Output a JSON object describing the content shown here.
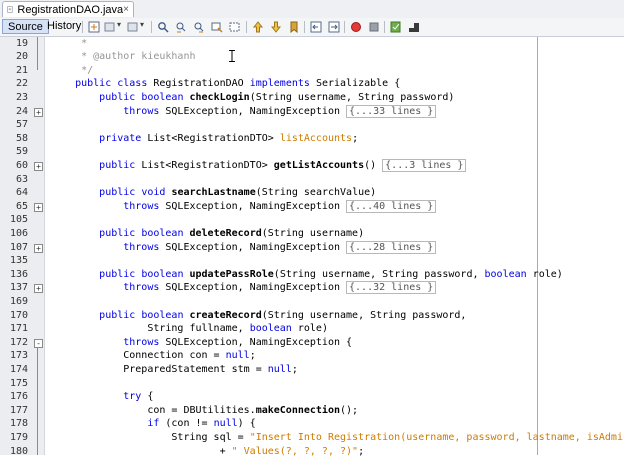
{
  "tab": {
    "title": "RegistrationDAO.java",
    "close": "×"
  },
  "toolbar": {
    "source": "Source",
    "history": "History"
  },
  "lines": [
    {
      "n": "19",
      "fold": "",
      "tokens": [
        {
          "t": "     *",
          "c": "cmt"
        }
      ]
    },
    {
      "n": "20",
      "fold": "",
      "tokens": [
        {
          "t": "     * @author kieukhanh",
          "c": "cmt"
        }
      ]
    },
    {
      "n": "21",
      "fold": "",
      "tokens": [
        {
          "t": "     */",
          "c": "cmt"
        }
      ]
    },
    {
      "n": "22",
      "fold": "",
      "tokens": [
        {
          "t": "    ",
          "c": ""
        },
        {
          "t": "public class",
          "c": "kw"
        },
        {
          "t": " RegistrationDAO ",
          "c": ""
        },
        {
          "t": "implements",
          "c": "kw"
        },
        {
          "t": " Serializable {",
          "c": ""
        }
      ]
    },
    {
      "n": "23",
      "fold": "",
      "tokens": [
        {
          "t": "        ",
          "c": ""
        },
        {
          "t": "public boolean",
          "c": "kw"
        },
        {
          "t": " ",
          "c": ""
        },
        {
          "t": "checkLogin",
          "c": "b"
        },
        {
          "t": "(String username, String password)",
          "c": ""
        }
      ]
    },
    {
      "n": "24",
      "fold": "+",
      "tokens": [
        {
          "t": "            ",
          "c": ""
        },
        {
          "t": "throws",
          "c": "kw"
        },
        {
          "t": " SQLException, NamingException ",
          "c": ""
        },
        {
          "t": "{...33 lines }",
          "c": "foldbox"
        }
      ]
    },
    {
      "n": "57",
      "fold": "",
      "tokens": []
    },
    {
      "n": "58",
      "fold": "",
      "tokens": [
        {
          "t": "        ",
          "c": ""
        },
        {
          "t": "private",
          "c": "kw"
        },
        {
          "t": " List<RegistrationDTO> ",
          "c": ""
        },
        {
          "t": "listAccounts",
          "c": "str"
        },
        {
          "t": ";",
          "c": ""
        }
      ]
    },
    {
      "n": "59",
      "fold": "",
      "tokens": []
    },
    {
      "n": "60",
      "fold": "+",
      "tokens": [
        {
          "t": "        ",
          "c": ""
        },
        {
          "t": "public",
          "c": "kw"
        },
        {
          "t": " List<RegistrationDTO> ",
          "c": ""
        },
        {
          "t": "getListAccounts",
          "c": "b"
        },
        {
          "t": "() ",
          "c": ""
        },
        {
          "t": "{...3 lines }",
          "c": "foldbox"
        }
      ]
    },
    {
      "n": "63",
      "fold": "",
      "tokens": []
    },
    {
      "n": "64",
      "fold": "",
      "tokens": [
        {
          "t": "        ",
          "c": ""
        },
        {
          "t": "public void",
          "c": "kw"
        },
        {
          "t": " ",
          "c": ""
        },
        {
          "t": "searchLastname",
          "c": "b"
        },
        {
          "t": "(String searchValue)",
          "c": ""
        }
      ]
    },
    {
      "n": "65",
      "fold": "+",
      "tokens": [
        {
          "t": "            ",
          "c": ""
        },
        {
          "t": "throws",
          "c": "kw"
        },
        {
          "t": " SQLException, NamingException ",
          "c": ""
        },
        {
          "t": "{...40 lines }",
          "c": "foldbox"
        }
      ]
    },
    {
      "n": "105",
      "fold": "",
      "tokens": []
    },
    {
      "n": "106",
      "fold": "",
      "tokens": [
        {
          "t": "        ",
          "c": ""
        },
        {
          "t": "public boolean",
          "c": "kw"
        },
        {
          "t": " ",
          "c": ""
        },
        {
          "t": "deleteRecord",
          "c": "b"
        },
        {
          "t": "(String username)",
          "c": ""
        }
      ]
    },
    {
      "n": "107",
      "fold": "+",
      "tokens": [
        {
          "t": "            ",
          "c": ""
        },
        {
          "t": "throws",
          "c": "kw"
        },
        {
          "t": " SQLException, NamingException ",
          "c": ""
        },
        {
          "t": "{...28 lines }",
          "c": "foldbox"
        }
      ]
    },
    {
      "n": "135",
      "fold": "",
      "tokens": []
    },
    {
      "n": "136",
      "fold": "",
      "tokens": [
        {
          "t": "        ",
          "c": ""
        },
        {
          "t": "public boolean",
          "c": "kw"
        },
        {
          "t": " ",
          "c": ""
        },
        {
          "t": "updatePassRole",
          "c": "b"
        },
        {
          "t": "(String username, String password, ",
          "c": ""
        },
        {
          "t": "boolean",
          "c": "kw"
        },
        {
          "t": " role)",
          "c": ""
        }
      ]
    },
    {
      "n": "137",
      "fold": "+",
      "tokens": [
        {
          "t": "            ",
          "c": ""
        },
        {
          "t": "throws",
          "c": "kw"
        },
        {
          "t": " SQLException, NamingException ",
          "c": ""
        },
        {
          "t": "{...32 lines }",
          "c": "foldbox"
        }
      ]
    },
    {
      "n": "169",
      "fold": "",
      "tokens": []
    },
    {
      "n": "170",
      "fold": "",
      "tokens": [
        {
          "t": "        ",
          "c": ""
        },
        {
          "t": "public boolean",
          "c": "kw"
        },
        {
          "t": " ",
          "c": ""
        },
        {
          "t": "createRecord",
          "c": "b"
        },
        {
          "t": "(String username, String password,",
          "c": ""
        }
      ]
    },
    {
      "n": "171",
      "fold": "",
      "tokens": [
        {
          "t": "                String fullname, ",
          "c": ""
        },
        {
          "t": "boolean",
          "c": "kw"
        },
        {
          "t": " role)",
          "c": ""
        }
      ]
    },
    {
      "n": "172",
      "fold": "-",
      "tokens": [
        {
          "t": "            ",
          "c": ""
        },
        {
          "t": "throws",
          "c": "kw"
        },
        {
          "t": " SQLException, NamingException {",
          "c": ""
        }
      ]
    },
    {
      "n": "173",
      "fold": "",
      "tokens": [
        {
          "t": "            Connection con = ",
          "c": ""
        },
        {
          "t": "null",
          "c": "kw"
        },
        {
          "t": ";",
          "c": ""
        }
      ]
    },
    {
      "n": "174",
      "fold": "",
      "tokens": [
        {
          "t": "            PreparedStatement stm = ",
          "c": ""
        },
        {
          "t": "null",
          "c": "kw"
        },
        {
          "t": ";",
          "c": ""
        }
      ]
    },
    {
      "n": "175",
      "fold": "",
      "tokens": []
    },
    {
      "n": "176",
      "fold": "",
      "tokens": [
        {
          "t": "            ",
          "c": ""
        },
        {
          "t": "try",
          "c": "kw"
        },
        {
          "t": " {",
          "c": ""
        }
      ]
    },
    {
      "n": "177",
      "fold": "",
      "tokens": [
        {
          "t": "                con = DBUtilities.",
          "c": ""
        },
        {
          "t": "makeConnection",
          "c": "b"
        },
        {
          "t": "();",
          "c": ""
        }
      ]
    },
    {
      "n": "178",
      "fold": "",
      "tokens": [
        {
          "t": "                ",
          "c": ""
        },
        {
          "t": "if",
          "c": "kw"
        },
        {
          "t": " (con != ",
          "c": ""
        },
        {
          "t": "null",
          "c": "kw"
        },
        {
          "t": ") {",
          "c": ""
        }
      ]
    },
    {
      "n": "179",
      "fold": "",
      "tokens": [
        {
          "t": "                    String sql = ",
          "c": ""
        },
        {
          "t": "\"Insert Into Registration(username, password, lastname, isAdmin)\"",
          "c": "str"
        }
      ]
    },
    {
      "n": "180",
      "fold": "",
      "tokens": [
        {
          "t": "                            + ",
          "c": ""
        },
        {
          "t": "\" Values(?, ?, ?, ?)\"",
          "c": "str"
        },
        {
          "t": ";",
          "c": ""
        }
      ]
    }
  ]
}
